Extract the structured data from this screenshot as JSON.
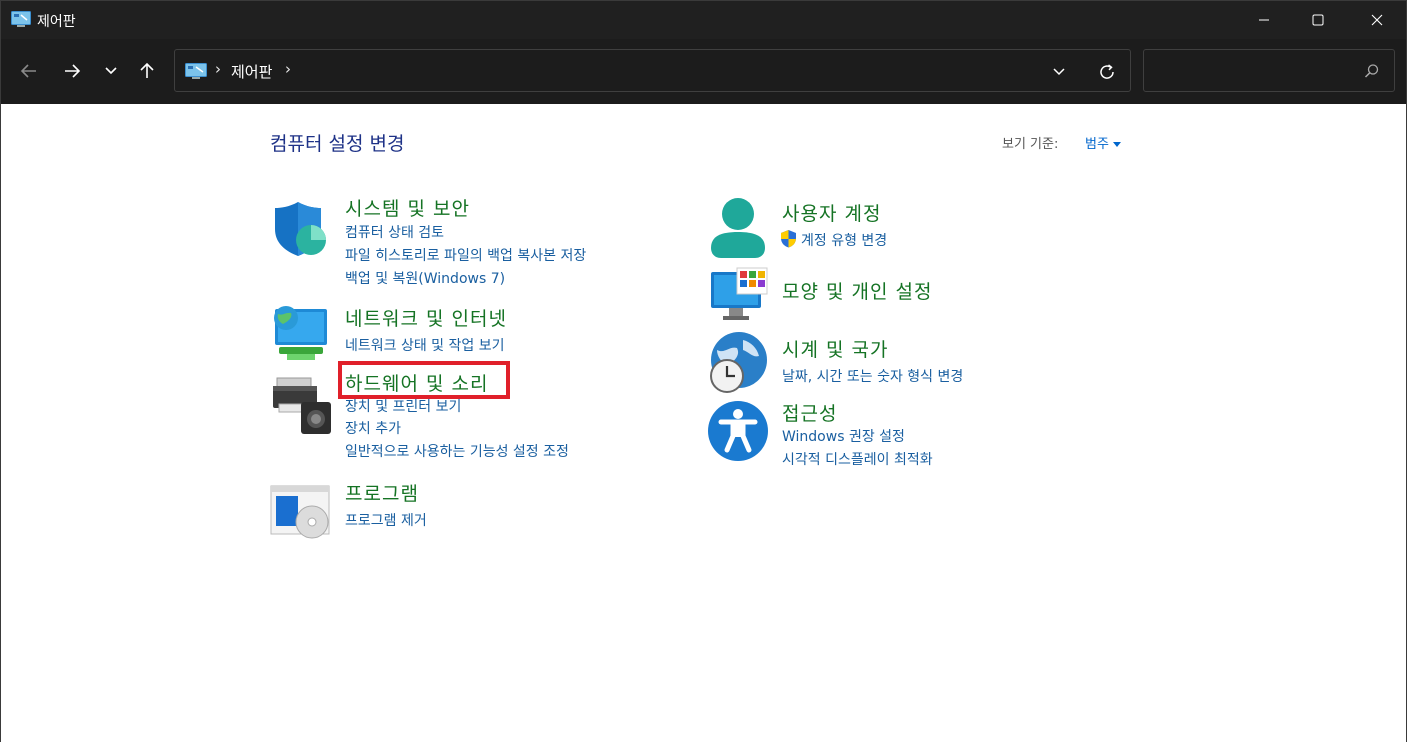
{
  "window": {
    "title": "제어판",
    "icon": "control-panel-icon",
    "controls": [
      "minimize-icon",
      "maximize-icon",
      "close-icon"
    ]
  },
  "navigation": {
    "address_crumbs": [
      "제어판"
    ],
    "separator": "›",
    "search_placeholder": ""
  },
  "page": {
    "title": "컴퓨터 설정 변경",
    "view_by_label": "보기 기준:",
    "view_by_value": "범주"
  },
  "categories": {
    "system_security": {
      "title": "시스템 및 보안",
      "icon": "shield-icon",
      "links": [
        "컴퓨터 상태 검토",
        "파일 히스토리로 파일의 백업 복사본 저장",
        "백업 및 복원(Windows 7)"
      ]
    },
    "network": {
      "title": "네트워크 및 인터넷",
      "icon": "globe-monitor-icon",
      "links": [
        "네트워크 상태 및 작업 보기"
      ]
    },
    "hardware_sound": {
      "title": "하드웨어 및 소리",
      "icon": "printer-speaker-icon",
      "links": [
        "장치 및 프린터 보기",
        "장치 추가",
        "일반적으로 사용하는 기능성 설정 조정"
      ]
    },
    "programs": {
      "title": "프로그램",
      "icon": "programs-disc-icon",
      "links": [
        "프로그램 제거"
      ]
    },
    "user_accounts": {
      "title": "사용자 계정",
      "icon": "user-icon",
      "links": [
        "계정 유형 변경"
      ]
    },
    "appearance": {
      "title": "모양 및 개인 설정",
      "icon": "monitor-tiles-icon",
      "links": []
    },
    "clock_region": {
      "title": "시계 및 국가",
      "icon": "clock-globe-icon",
      "links": [
        "날짜, 시간 또는 숫자 형식 변경"
      ]
    },
    "accessibility": {
      "title": "접근성",
      "icon": "accessibility-icon",
      "links": [
        "Windows 권장 설정",
        "시각적 디스플레이 최적화"
      ]
    }
  },
  "annotation": {
    "highlight_color": "#e0202a",
    "highlight_target": "hardware_sound"
  },
  "colors": {
    "category_title": "#157324",
    "link": "#1a5fa0",
    "page_title": "#1e3287"
  }
}
